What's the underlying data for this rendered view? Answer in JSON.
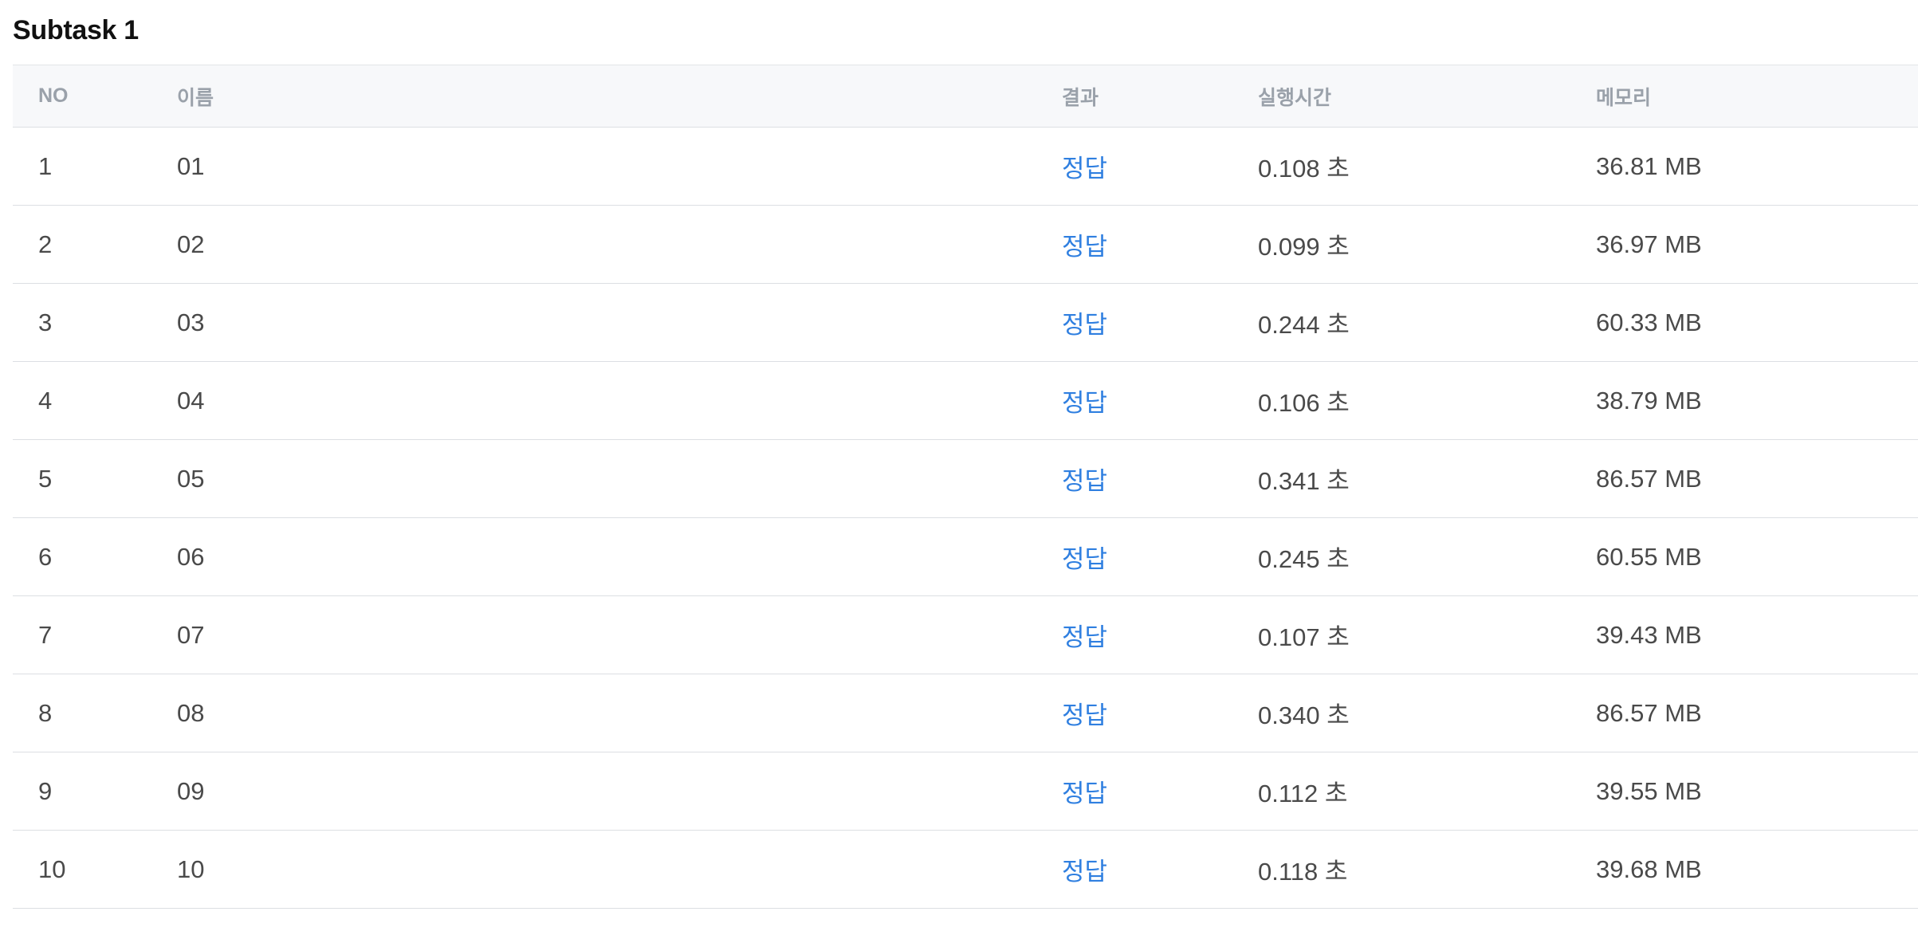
{
  "subtask": {
    "title": "Subtask 1"
  },
  "table": {
    "headers": {
      "no": "NO",
      "name": "이름",
      "result": "결과",
      "time": "실행시간",
      "memory": "메모리"
    },
    "rows": [
      {
        "no": "1",
        "name": "01",
        "result": "정답",
        "time": "0.108 초",
        "memory": "36.81 MB"
      },
      {
        "no": "2",
        "name": "02",
        "result": "정답",
        "time": "0.099 초",
        "memory": "36.97 MB"
      },
      {
        "no": "3",
        "name": "03",
        "result": "정답",
        "time": "0.244 초",
        "memory": "60.33 MB"
      },
      {
        "no": "4",
        "name": "04",
        "result": "정답",
        "time": "0.106 초",
        "memory": "38.79 MB"
      },
      {
        "no": "5",
        "name": "05",
        "result": "정답",
        "time": "0.341 초",
        "memory": "86.57 MB"
      },
      {
        "no": "6",
        "name": "06",
        "result": "정답",
        "time": "0.245 초",
        "memory": "60.55 MB"
      },
      {
        "no": "7",
        "name": "07",
        "result": "정답",
        "time": "0.107 초",
        "memory": "39.43 MB"
      },
      {
        "no": "8",
        "name": "08",
        "result": "정답",
        "time": "0.340 초",
        "memory": "86.57 MB"
      },
      {
        "no": "9",
        "name": "09",
        "result": "정답",
        "time": "0.112 초",
        "memory": "39.55 MB"
      },
      {
        "no": "10",
        "name": "10",
        "result": "정답",
        "time": "0.118 초",
        "memory": "39.68 MB"
      }
    ]
  },
  "colors": {
    "accepted": "#2f7fe0",
    "header_text": "#9aa1aa",
    "header_bg": "#f7f8fa",
    "row_border": "#dcdfe3"
  }
}
